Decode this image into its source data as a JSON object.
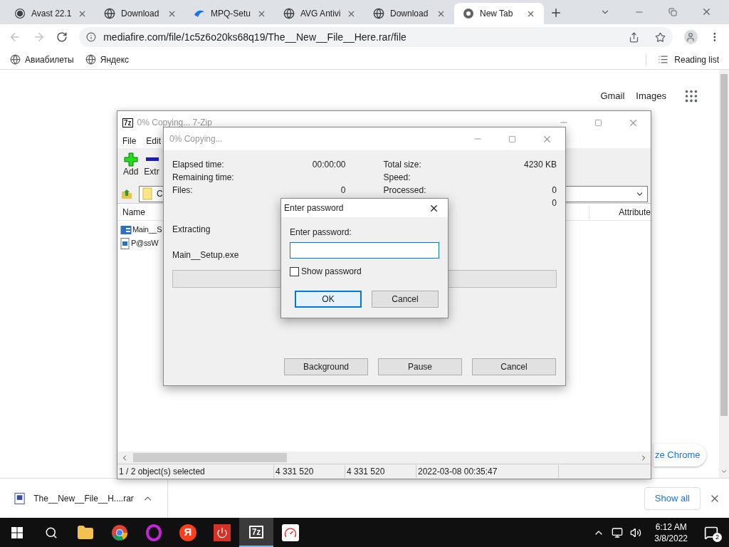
{
  "browser": {
    "tabs": [
      {
        "title": "Avast 22.1",
        "kind": "wordpress",
        "selected": false
      },
      {
        "title": "Download",
        "kind": "globe",
        "selected": false
      },
      {
        "title": "MPQ-Setu",
        "kind": "swoosh",
        "selected": false
      },
      {
        "title": "AVG Antivi",
        "kind": "globe",
        "selected": false
      },
      {
        "title": "Download",
        "kind": "globe",
        "selected": false
      },
      {
        "title": "New Tab",
        "kind": "chrome",
        "selected": true
      }
    ],
    "url": "mediafire.com/file/1c5z6o20ks68q19/The__New__File__Here.rar/file",
    "bookmarks": [
      "Авиабилеты",
      "Яндекс"
    ],
    "reading_list": "Reading list",
    "page_links": [
      "Gmail",
      "Images"
    ],
    "customize_button": "ze Chrome",
    "download": "The__New__File__H....rar",
    "show_all": "Show all"
  },
  "sevenzip": {
    "badge": "7z",
    "title": "0% Copying... 7-Zip",
    "menu": [
      "File",
      "Edit"
    ],
    "toolbar": [
      {
        "label": "Add",
        "kind": "add"
      },
      {
        "label": "Extr",
        "kind": "extract"
      }
    ],
    "path": "C",
    "columns": [
      "Name",
      "Attribute"
    ],
    "rows": [
      {
        "name": "Main__S",
        "kind": "exe"
      },
      {
        "name": "P@ssW",
        "kind": "image"
      }
    ],
    "status": [
      "1 / 2 object(s) selected",
      "4 331 520",
      "4 331 520",
      "2022-03-08 00:35:47"
    ]
  },
  "progress": {
    "title": "0% Copying...",
    "left": [
      {
        "label": "Elapsed time:",
        "value": "00:00:00"
      },
      {
        "label": "Remaining time:"
      },
      {
        "label": "Files:",
        "value": "0"
      }
    ],
    "right": [
      {
        "label": "Total size:",
        "value": "4230 KB"
      },
      {
        "label": "Speed:"
      },
      {
        "label": "Processed:",
        "value": "0"
      },
      {
        "value": "0"
      }
    ],
    "operation": "Extracting",
    "file": "Main__Setup.exe",
    "level": 0,
    "buttons": [
      "Background",
      "Pause",
      "Cancel"
    ]
  },
  "password": {
    "title": "Enter password",
    "label": "Enter password:",
    "show_password": {
      "label": "Show password",
      "checked": false
    },
    "buttons": [
      {
        "label": "OK",
        "focused": true
      },
      {
        "label": "Cancel",
        "focused": false
      }
    ]
  },
  "taskbar": {
    "apps": [
      {
        "kind": "explorer",
        "active": false
      },
      {
        "kind": "chrome",
        "active": false
      },
      {
        "kind": "opera",
        "active": false
      },
      {
        "kind": "yandex",
        "text": "Я",
        "active": false
      },
      {
        "kind": "power",
        "active": false
      },
      {
        "kind": "sevenzip",
        "text": "7z",
        "active": true
      },
      {
        "kind": "gauge",
        "active": false
      }
    ],
    "time": "6:12 AM",
    "date": "3/8/2022",
    "notifications": "2"
  }
}
